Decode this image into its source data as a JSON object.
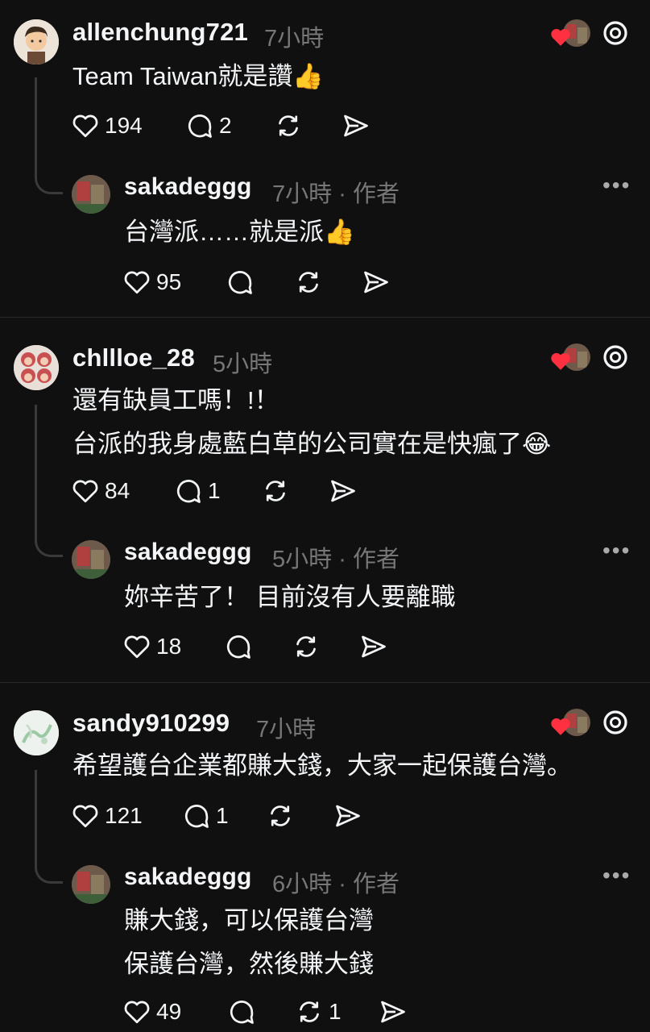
{
  "threads": [
    {
      "user": "allenchung721",
      "time": "7小時",
      "text_lines": [
        "Team Taiwan就是讚👍"
      ],
      "likes": "194",
      "replies": "2",
      "reply": {
        "user": "sakadeggg",
        "time": "7小時",
        "author_tag": "作者",
        "text_lines": [
          "台灣派……就是派👍"
        ],
        "likes": "95",
        "replies": "",
        "reposts": ""
      }
    },
    {
      "user": "chllloe_28",
      "time": "5小時",
      "text_lines": [
        "還有缺員工嗎！!！",
        "台派的我身處藍白草的公司實在是快瘋了😂"
      ],
      "likes": "84",
      "replies": "1",
      "reply": {
        "user": "sakadeggg",
        "time": "5小時",
        "author_tag": "作者",
        "text_lines": [
          "妳辛苦了！ 目前沒有人要離職"
        ],
        "likes": "18",
        "replies": "",
        "reposts": ""
      }
    },
    {
      "user": "sandy910299",
      "time": "7小時",
      "text_lines": [
        "希望護台企業都賺大錢，大家一起保護台灣。"
      ],
      "likes": "121",
      "replies": "1",
      "reply": {
        "user": "sakadeggg",
        "time": "6小時",
        "author_tag": "作者",
        "text_lines": [
          "賺大錢，可以保護台灣",
          "保護台灣，然後賺大錢"
        ],
        "likes": "49",
        "replies": "",
        "reposts": "1"
      }
    }
  ],
  "dot_separator": "·",
  "more_label": "•••",
  "colors": {
    "background": "#101010",
    "text": "#f3f5f7",
    "muted": "#777777",
    "heart": "#ff3040"
  }
}
